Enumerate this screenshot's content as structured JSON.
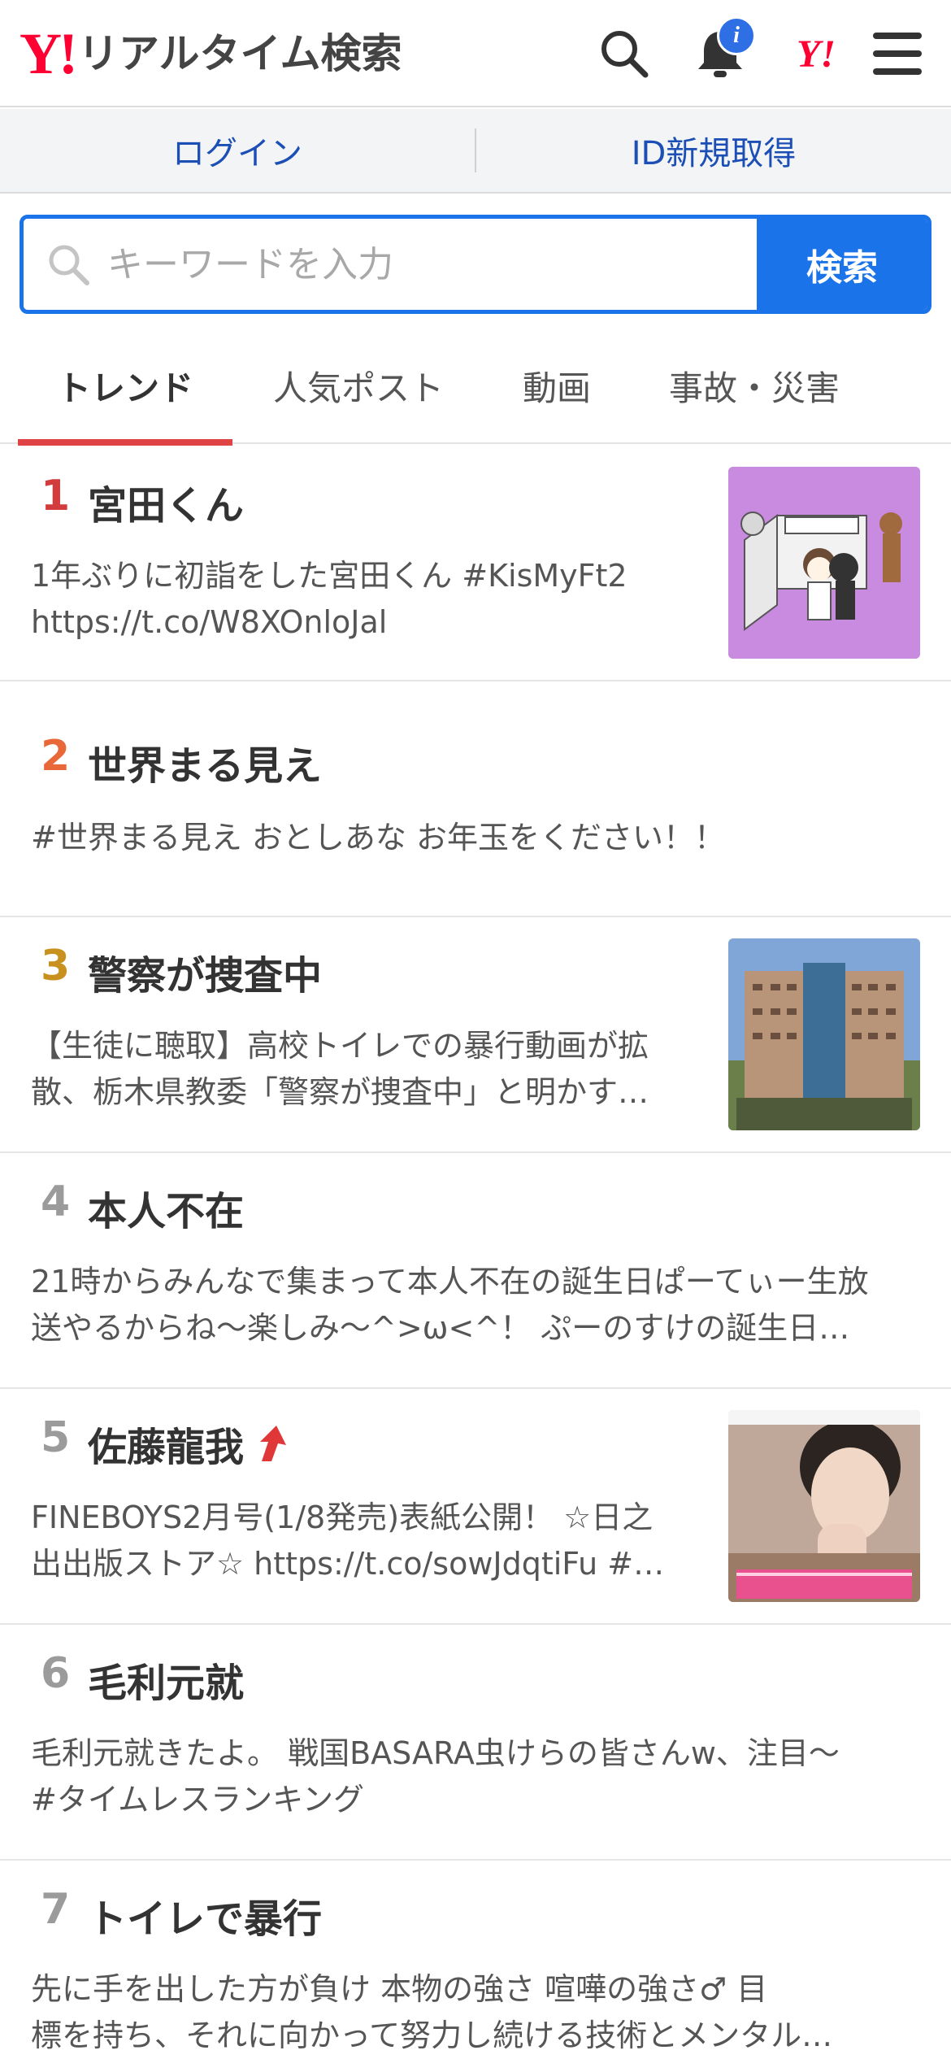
{
  "header": {
    "logo_mark": "Y!",
    "logo_text": "リアルタイム検索",
    "notification_badge": "i",
    "yahoo_mini": "Y!"
  },
  "login_bar": {
    "login": "ログイン",
    "register": "ID新規取得"
  },
  "search": {
    "placeholder": "キーワードを入力",
    "button": "検索"
  },
  "tabs": [
    {
      "label": "トレンド",
      "active": true
    },
    {
      "label": "人気ポスト",
      "active": false
    },
    {
      "label": "動画",
      "active": false
    },
    {
      "label": "事故・災害",
      "active": false
    }
  ],
  "trends": [
    {
      "rank": "1",
      "rank_color": "#d23c3c",
      "title": "宮田くん",
      "lines": [
        "1年ぶりに初詣をした宮田くん #KisMyFt2",
        "https://t.co/W8XOnloJal"
      ],
      "has_thumb": true,
      "thumb_icon": "illustration-thumbnail"
    },
    {
      "rank": "2",
      "rank_color": "#e8683a",
      "title": "世界まる見え",
      "lines": [
        "#世界まる見え おとしあな お年玉をください！！"
      ],
      "has_thumb": false
    },
    {
      "rank": "3",
      "rank_color": "#c8901d",
      "title": "警察が捜査中",
      "lines": [
        "【生徒に聴取】高校トイレでの暴行動画が拡",
        "散、栃木県教委「警察が捜査中」と明かす…"
      ],
      "has_thumb": true,
      "thumb_icon": "building-photo-thumbnail"
    },
    {
      "rank": "4",
      "rank_color": "#9b9b9b",
      "title": "本人不在",
      "lines": [
        "21時からみんなで集まって本人不在の誕生日ぱーてぃー生放",
        "送やるからね〜楽しみ〜^>ω<^󠀠！ ぷーのすけの誕生日…"
      ],
      "has_thumb": false
    },
    {
      "rank": "5",
      "rank_color": "#9b9b9b",
      "title": "佐藤龍我",
      "trending_up": true,
      "lines": [
        "FINEBOYS2月号(1/8発売)表紙公開！ ☆日之",
        "出出版ストア☆ https://t.co/sowJdqtiFu #…"
      ],
      "has_thumb": true,
      "thumb_icon": "magazine-cover-thumbnail"
    },
    {
      "rank": "6",
      "rank_color": "#9b9b9b",
      "title": "毛利元就",
      "lines": [
        "毛利元就きたよ。 戦国BASARA虫けらの皆さんw、注目〜",
        "#タイムレスランキング"
      ],
      "has_thumb": false
    },
    {
      "rank": "7",
      "rank_color": "#9b9b9b",
      "title": "トイレで暴行",
      "lines": [
        "先に手を出した方が負け󠀠 󠀠本物の強さ󠀠 喧嘩の強さ󠀠♂ 目",
        "標を持ち、それに向かって努力し続ける技術とメンタル…"
      ],
      "has_thumb": false
    }
  ]
}
